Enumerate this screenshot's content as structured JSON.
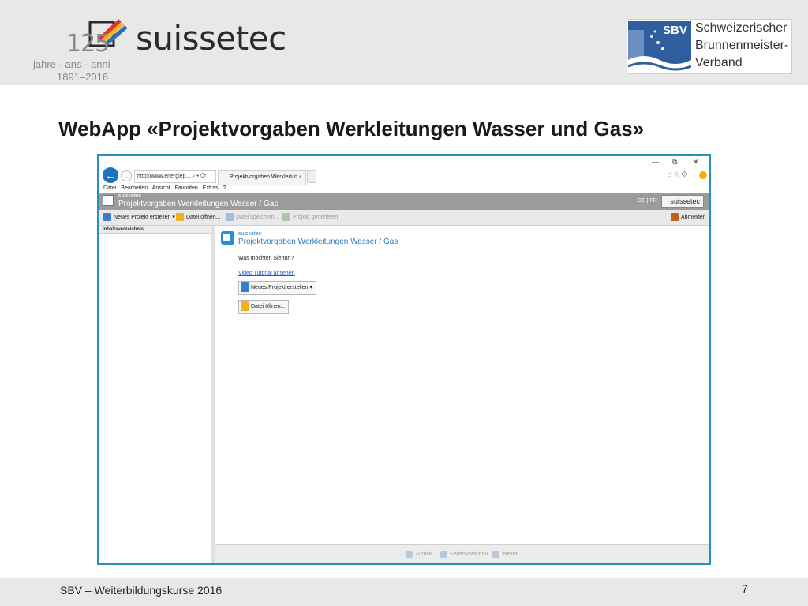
{
  "slide": {
    "logo": {
      "number": "125",
      "brand": "suissetec",
      "sub1": "jahre · ans · anni",
      "sub2": "1891–2016"
    },
    "sbv": {
      "abbr": "SBV",
      "line1": "Schweizerischer",
      "line2": "Brunnenmeister-",
      "line3": "Verband"
    },
    "title": "WebApp «Projektvorgaben Werkleitungen Wasser und Gas»",
    "footer_left": "SBV – Weiterbildungskurse 2016",
    "page_number": "7"
  },
  "browser": {
    "address": "http://www.energiep...",
    "address_icons": "⌕ ▾ ⟳",
    "tab_title": "Projektvorgaben Werkleitun...",
    "tab_close": "×",
    "window_controls": {
      "minimize": "—",
      "restore": "⧉",
      "close": "✕"
    },
    "menu": [
      "Datei",
      "Bearbeiten",
      "Ansicht",
      "Favoriten",
      "Extras",
      "?"
    ]
  },
  "app": {
    "header_sub": "suissetec",
    "header_title": "Projektvorgaben Werkleitungen Wasser / Gas",
    "lang": "DE | FR",
    "brand_button": "suissetec",
    "toolbar": {
      "new_project": "Neues Projekt erstellen ▾",
      "open_file": "Datei öffnen...",
      "save_file": "Datei speichern...",
      "generate": "Projekt generieren",
      "logout": "Abmelden"
    },
    "sidebar_header": "Inhaltsverzeichnis",
    "content": {
      "sub": "suissetec",
      "title": "Projektvorgaben Werkleitungen Wasser / Gas",
      "question": "Was möchten Sie tun?",
      "video_link": "Video Tutorial ansehen",
      "new_project_btn": "Neues Projekt erstellen ▾",
      "open_file_btn": "Datei öffnen..."
    },
    "footer": {
      "back": "Zurück",
      "preview": "Seitenvorschau",
      "next": "Weiter"
    }
  },
  "colors": {
    "frame": "#2a8fbd",
    "accent": "#2a7ec4",
    "header_gray": "#9c9c9c",
    "sbv_blue": "#2f5e9e"
  }
}
